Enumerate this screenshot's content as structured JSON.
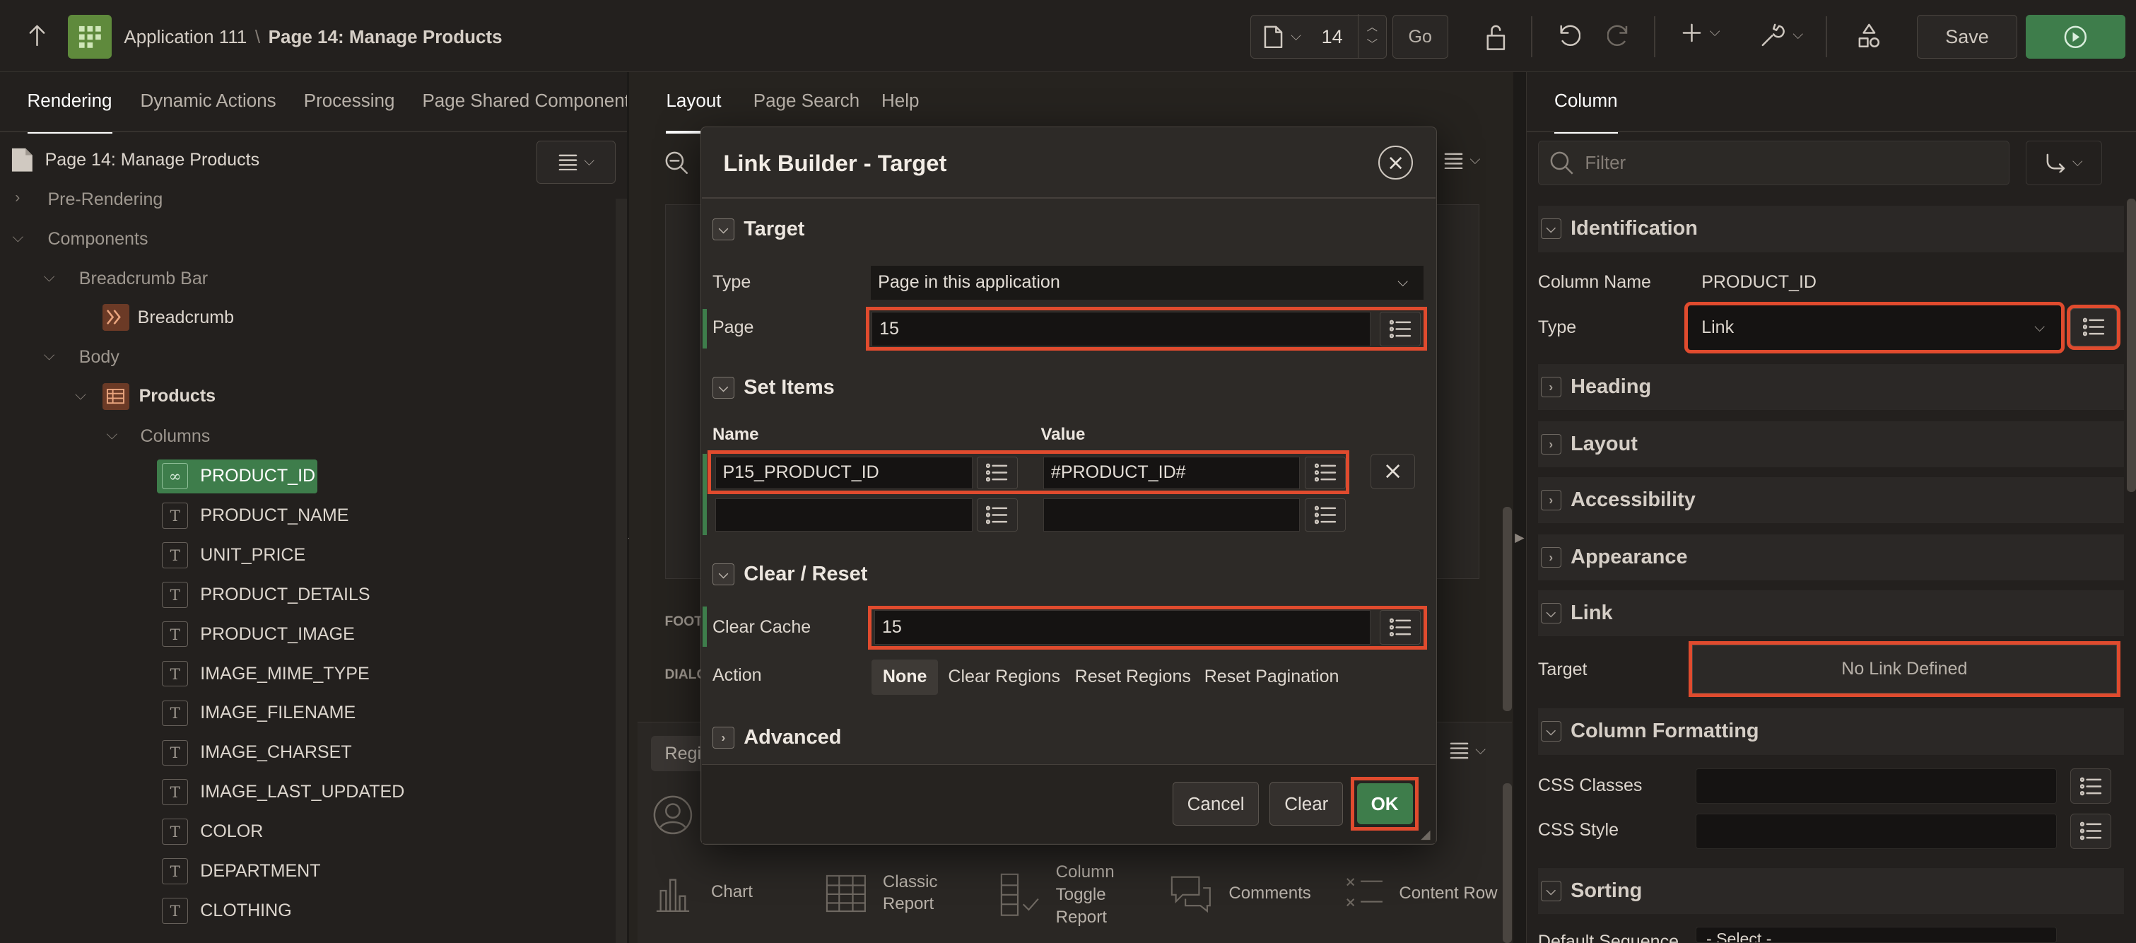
{
  "header": {
    "app": "Application 111",
    "separator": "\\",
    "page": "Page 14: Manage Products",
    "page_number": "14",
    "go": "Go",
    "save": "Save"
  },
  "left": {
    "tabs": [
      "Rendering",
      "Dynamic Actions",
      "Processing",
      "Page Shared Components"
    ],
    "root": "Page 14: Manage Products",
    "pre_rendering": "Pre-Rendering",
    "components": "Components",
    "breadcrumb_bar": "Breadcrumb Bar",
    "breadcrumb": "Breadcrumb",
    "body": "Body",
    "products": "Products",
    "columns_label": "Columns",
    "columns": [
      "PRODUCT_ID",
      "PRODUCT_NAME",
      "UNIT_PRICE",
      "PRODUCT_DETAILS",
      "PRODUCT_IMAGE",
      "IMAGE_MIME_TYPE",
      "IMAGE_FILENAME",
      "IMAGE_CHARSET",
      "IMAGE_LAST_UPDATED",
      "COLOR",
      "DEPARTMENT",
      "CLOTHING"
    ]
  },
  "middle": {
    "tabs": [
      "Layout",
      "Page Search",
      "Help"
    ],
    "regions": "Regi",
    "gallery": [
      "Chart",
      "Classic Report",
      "Column Toggle Report",
      "Comments",
      "Content Row"
    ],
    "foot": "FOOT",
    "dialo": "DIALO"
  },
  "right": {
    "tab": "Column",
    "filter_placeholder": "Filter",
    "sections": [
      "Identification",
      "Heading",
      "Layout",
      "Accessibility",
      "Appearance",
      "Link",
      "Column Formatting",
      "Sorting"
    ],
    "column_name_label": "Column Name",
    "column_name": "PRODUCT_ID",
    "type_label": "Type",
    "type_value": "Link",
    "target_label": "Target",
    "target_value": "No Link Defined",
    "css_classes": "CSS Classes",
    "css_style": "CSS Style",
    "default_sequence": "Default Sequence",
    "select": "- Select -"
  },
  "modal": {
    "title": "Link Builder - Target",
    "target_section": "Target",
    "type_label": "Type",
    "type_value": "Page in this application",
    "page_label": "Page",
    "page_value": "15",
    "set_items_section": "Set Items",
    "name_header": "Name",
    "value_header": "Value",
    "item_name": "P15_PRODUCT_ID",
    "item_value": "#PRODUCT_ID#",
    "clear_section": "Clear / Reset",
    "clear_cache_label": "Clear Cache",
    "clear_cache_value": "15",
    "action_label": "Action",
    "actions": [
      "None",
      "Clear Regions",
      "Reset Regions",
      "Reset Pagination"
    ],
    "advanced_section": "Advanced",
    "cancel": "Cancel",
    "clear": "Clear",
    "ok": "OK"
  },
  "colors": {
    "accent_green": "#3e7d4b",
    "highlight_red": "#e04b2e"
  }
}
